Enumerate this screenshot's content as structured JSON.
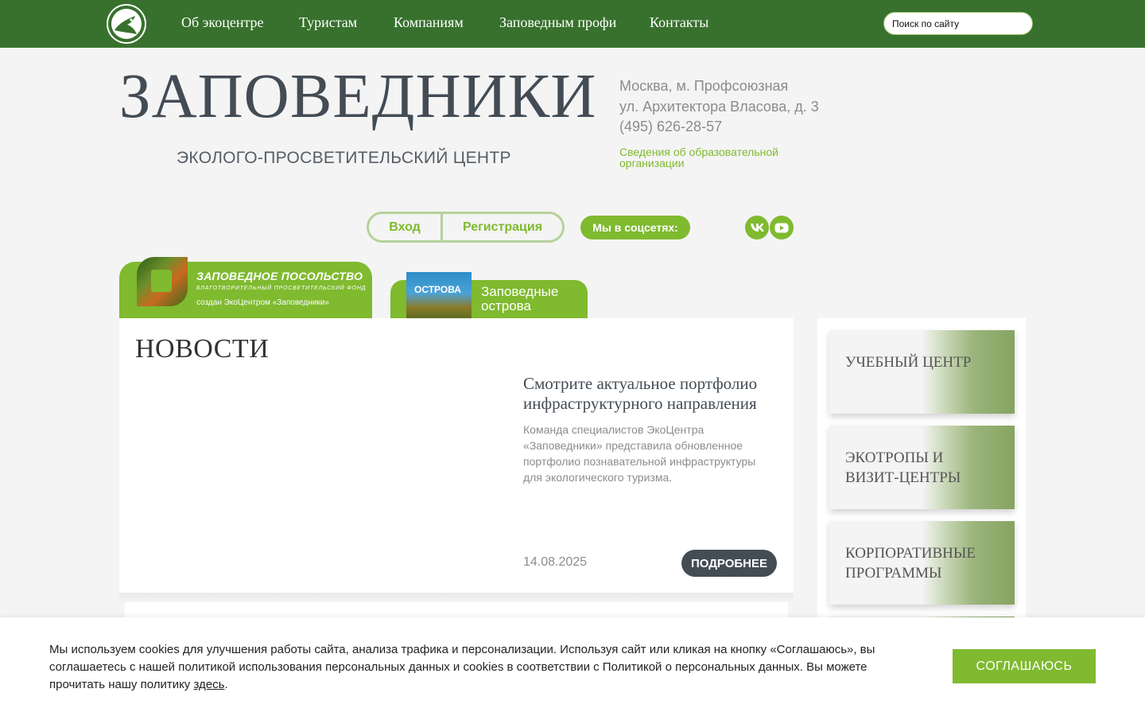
{
  "nav": {
    "items": [
      "Об экоцентре",
      "Туристам",
      "Компаниям",
      "Заповедным профи",
      "Контакты"
    ],
    "search_placeholder": "Поиск по сайту",
    "logo_icon": "bird-logo-icon"
  },
  "header": {
    "title": "ЗАПОВЕДНИКИ",
    "subtitle": "ЭКОЛОГО-ПРОСВЕТИТЕЛЬСКИЙ ЦЕНТР",
    "address_line1": "Москва, м. Профсоюзная",
    "address_line2": "ул. Архитектора Власова, д. 3",
    "phone": "(495) 626-28-57",
    "edu_link": "Сведения об образовательной организации"
  },
  "auth": {
    "login": "Вход",
    "register": "Регистрация"
  },
  "social": {
    "label": "Мы в соцсетях:",
    "icons": [
      "vk-icon",
      "youtube-icon"
    ]
  },
  "banners": {
    "embassy_title": "ЗАПОВЕДНОЕ ПОСОЛЬСТВО",
    "embassy_subtitle": "БЛАГОТВОРИТЕЛЬНЫЙ ПРОСВЕТИТЕЛЬСКИЙ ФОНД",
    "embassy_note": "создан ЭкоЦентром «Заповедники»",
    "islands_cover": "ОСТРОВА",
    "islands_title": "Заповедные острова"
  },
  "news": {
    "heading": "НОВОСТИ",
    "article_title": "Смотрите актуальное портфолио инфраструктурного направления",
    "article_text": "Команда специалистов ЭкоЦентра «Заповедники» представила обновленное портфолио познавательной инфраструктуры для экологического туризма.",
    "date": "14.08.2025",
    "more": "ПОДРОБНЕЕ"
  },
  "sidebar": {
    "items": [
      "УЧЕБНЫЙ ЦЕНТР",
      "ЭКОТРОПЫ И ВИЗИТ-ЦЕНТРЫ",
      "КОРПОРАТИВНЫЕ ПРОГРАММЫ"
    ]
  },
  "cookie": {
    "text": "Мы используем cookies для улучшения работы сайта, анализа трафика и персонализации. Используя сайт или кликая на кнопку «Соглашаюсь», вы соглашаетесь с нашей политикой использования персональных данных и cookies в соответствии с Политикой о персональных данных. Вы можете прочитать нашу политику ",
    "link": "здесь",
    "end": ".",
    "accept": "СОГЛАШАЮСЬ"
  },
  "colors": {
    "nav_green": "#37712d",
    "accent_green": "#7fba2f",
    "dark_button": "#444c55"
  }
}
